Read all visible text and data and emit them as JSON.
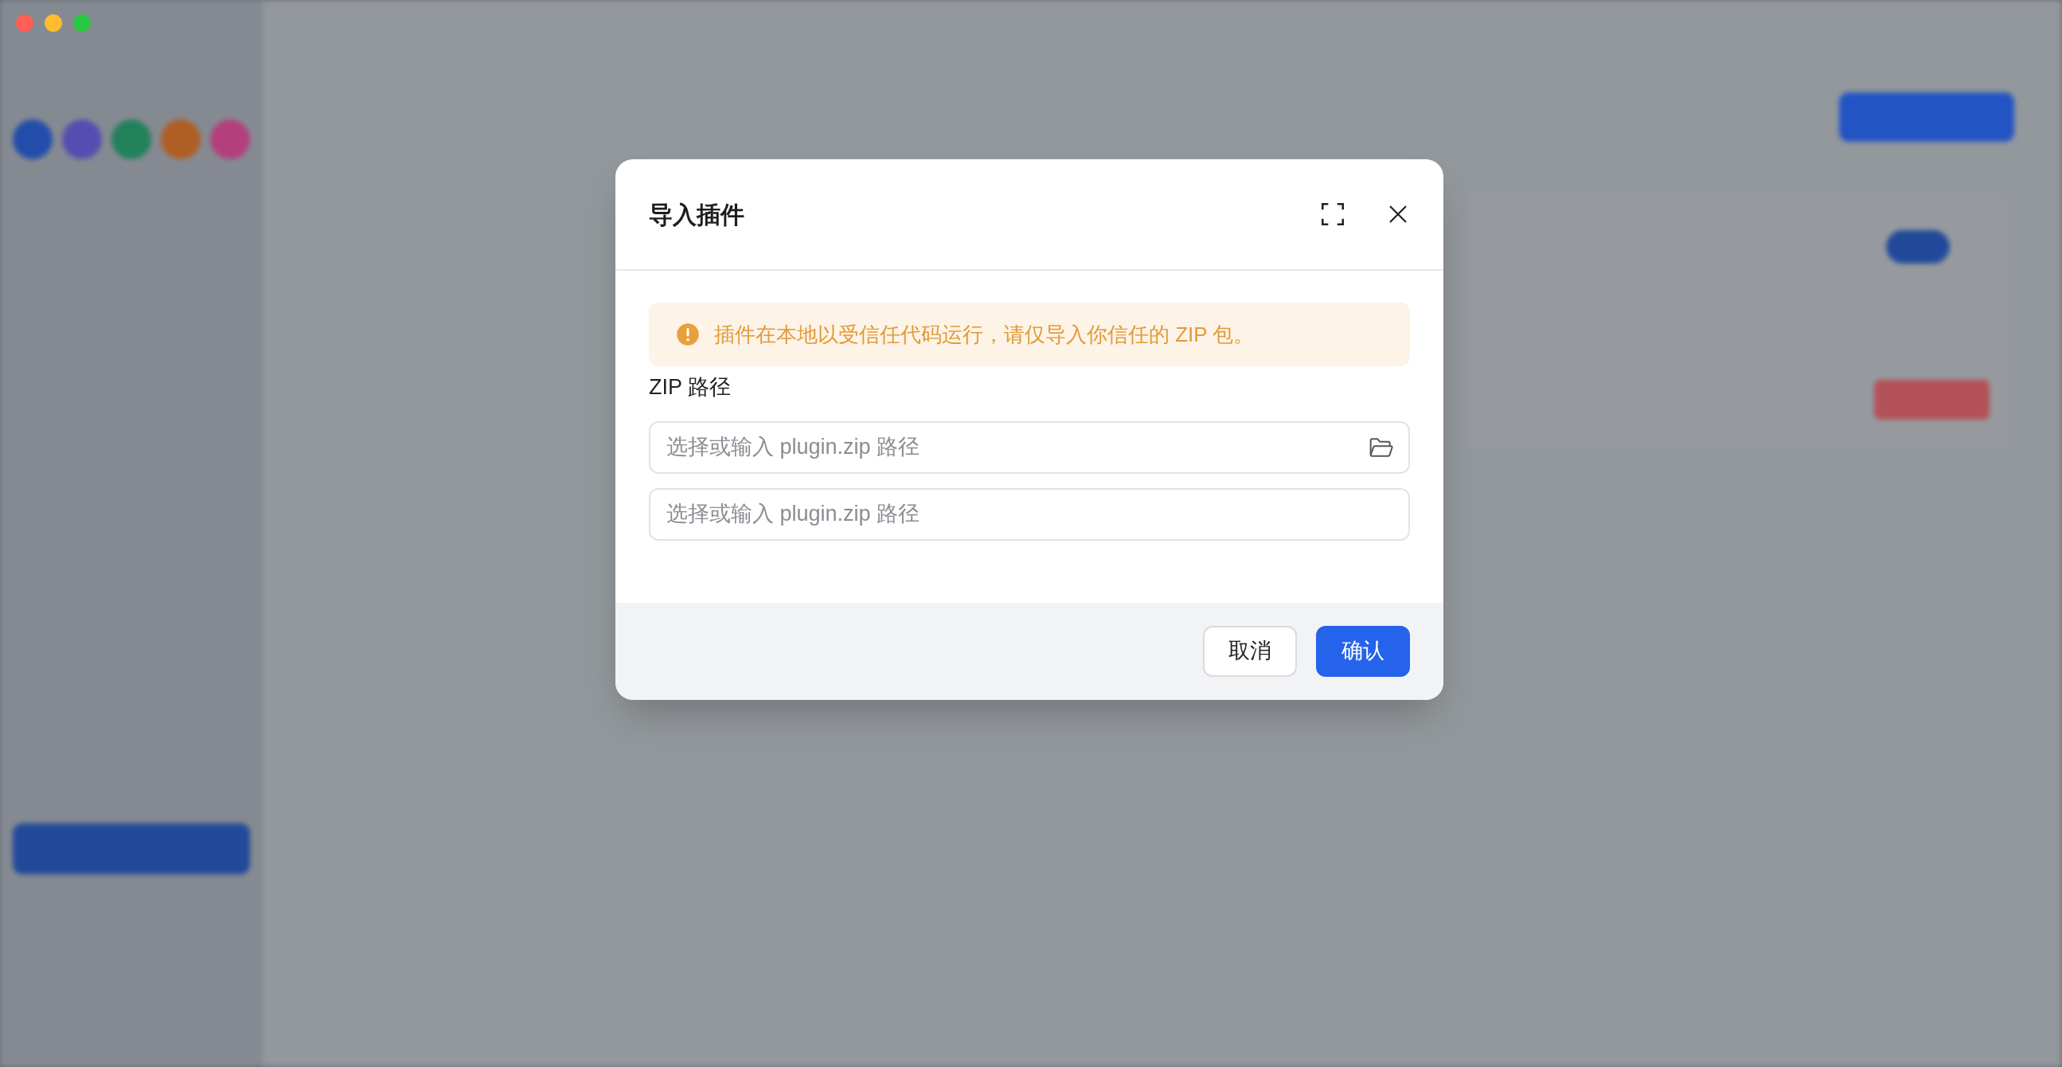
{
  "dialog": {
    "title": "导入插件",
    "alert": "插件在本地以受信任代码运行，请仅导入你信任的 ZIP 包。",
    "field_label": "ZIP 路径",
    "fields": [
      {
        "placeholder": "选择或输入 plugin.zip 路径",
        "kind": "browse"
      },
      {
        "placeholder": "选择或输入 plugin.zip 路径",
        "kind": "plain"
      }
    ],
    "buttons": [
      {
        "label": "取消",
        "kind": "secondary"
      },
      {
        "label": "确认",
        "kind": "primary"
      }
    ]
  }
}
